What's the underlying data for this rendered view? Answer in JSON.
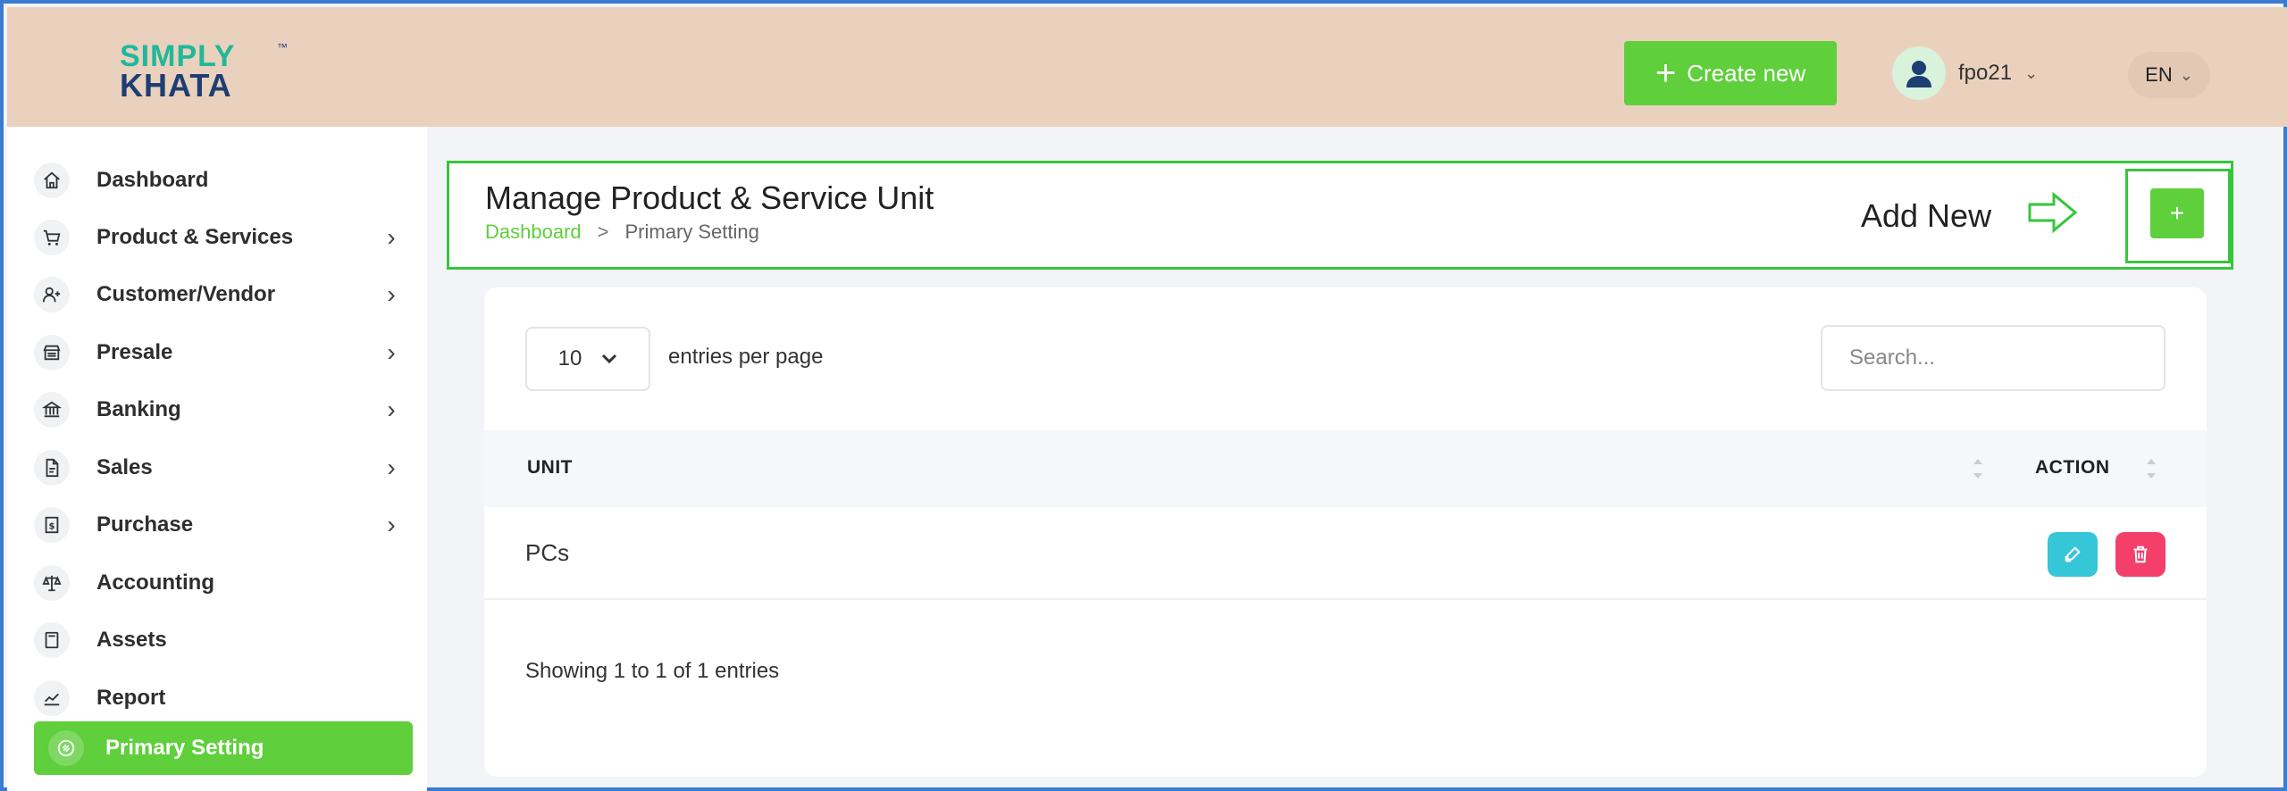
{
  "logo": {
    "line1": "SIMPLY",
    "line2": "KHATA",
    "tm": "™"
  },
  "header": {
    "create_label": "Create new",
    "user_name": "fpo21",
    "language": "EN"
  },
  "sidebar": {
    "items": [
      {
        "label": "Dashboard",
        "icon": "home-icon",
        "has_arrow": false
      },
      {
        "label": "Product & Services",
        "icon": "cart-icon",
        "has_arrow": true
      },
      {
        "label": "Customer/Vendor",
        "icon": "user-plus-icon",
        "has_arrow": true
      },
      {
        "label": "Presale",
        "icon": "store-icon",
        "has_arrow": true
      },
      {
        "label": "Banking",
        "icon": "bank-icon",
        "has_arrow": true
      },
      {
        "label": "Sales",
        "icon": "document-icon",
        "has_arrow": true
      },
      {
        "label": "Purchase",
        "icon": "receipt-icon",
        "has_arrow": true
      },
      {
        "label": "Accounting",
        "icon": "scale-icon",
        "has_arrow": false
      },
      {
        "label": "Assets",
        "icon": "calculator-icon",
        "has_arrow": false
      },
      {
        "label": "Report",
        "icon": "chart-icon",
        "has_arrow": false
      },
      {
        "label": "Primary Setting",
        "icon": "link-icon",
        "has_arrow": false,
        "active": true
      }
    ]
  },
  "main": {
    "title": "Manage Product & Service Unit",
    "breadcrumb": {
      "link": "Dashboard",
      "sep": ">",
      "current": "Primary Setting"
    },
    "add_new_label": "Add New",
    "add_button": "+"
  },
  "table": {
    "per_page_value": "10",
    "per_page_label": "entries per page",
    "search_placeholder": "Search...",
    "columns": [
      "UNIT",
      "ACTION"
    ],
    "rows": [
      {
        "unit": "PCs"
      }
    ],
    "footer": "Showing 1 to 1 of 1 entries"
  },
  "colors": {
    "accent": "#5fcf3c",
    "header_bg": "#ead1be",
    "edit": "#35c6d8",
    "delete": "#f53f6b"
  }
}
